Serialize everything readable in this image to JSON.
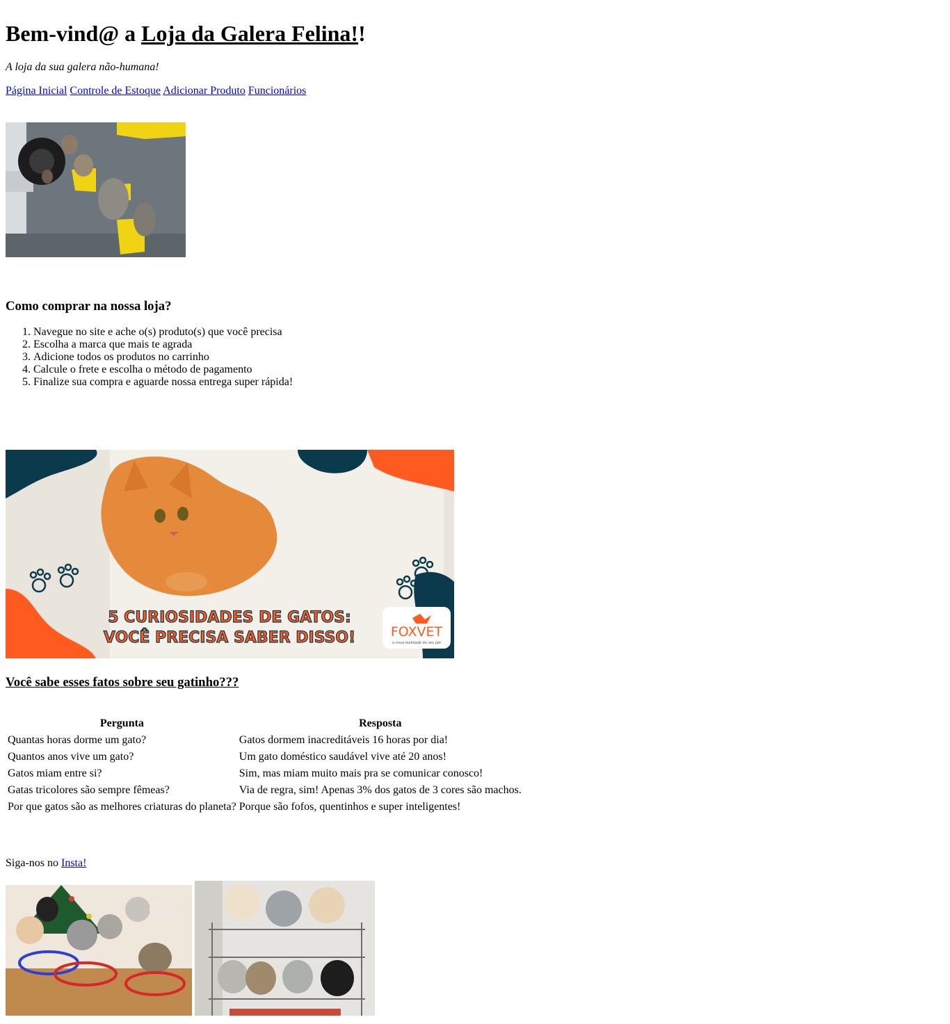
{
  "header": {
    "title_prefix": "Bem-vind@ a ",
    "title_link": "Loja da Galera Felina!",
    "title_suffix": "!",
    "tagline": "A loja da sua galera não-humana!"
  },
  "nav": {
    "items": [
      {
        "label": "Página Inicial"
      },
      {
        "label": "Controle de Estoque"
      },
      {
        "label": "Adicionar Produto"
      },
      {
        "label": "Funcionários"
      }
    ]
  },
  "images": {
    "hero": {
      "alt": "gatos na parede de prateleiras"
    },
    "banner": {
      "line1": "5 CURIOSIDADES DE GATOS:",
      "line2": "VOCÊ PRECISA SABER DISSO!",
      "brand": "FOXVET",
      "brand_tagline": "a nova realidade do seu pet"
    },
    "gallery": [
      {
        "alt": "gatos em baldes"
      },
      {
        "alt": "gatos em prateleira de arame"
      }
    ]
  },
  "howto": {
    "title": "Como comprar na nossa loja?",
    "steps": [
      "Navegue no site e ache o(s) produto(s) que você precisa",
      "Escolha a marca que mais te agrada",
      "Adicione todos os produtos no carrinho",
      "Calcule o frete e escolha o método de pagamento",
      "Finalize sua compra e aguarde nossa entrega super rápida!"
    ]
  },
  "facts": {
    "title": "Você sabe esses fatos sobre seu gatinho???",
    "headers": [
      "Pergunta",
      "Resposta"
    ],
    "rows": [
      [
        "Quantas horas dorme um gato?",
        "Gatos dormem inacreditáveis 16 horas por dia!"
      ],
      [
        "Quantos anos vive um gato?",
        "Um gato doméstico saudável vive até 20 anos!"
      ],
      [
        "Gatos miam entre si?",
        "Sim, mas miam muito mais pra se comunicar conosco!"
      ],
      [
        "Gatas tricolores são sempre fêmeas?",
        "Via de regra, sim! Apenas 3% dos gatos de 3 cores são machos."
      ],
      [
        "Por que gatos são as melhores criaturas do planeta?",
        "Porque são fofos, quentinhos e super inteligentes!"
      ]
    ]
  },
  "footer": {
    "follow_text": "Siga-nos no ",
    "insta_link": "Insta!"
  }
}
